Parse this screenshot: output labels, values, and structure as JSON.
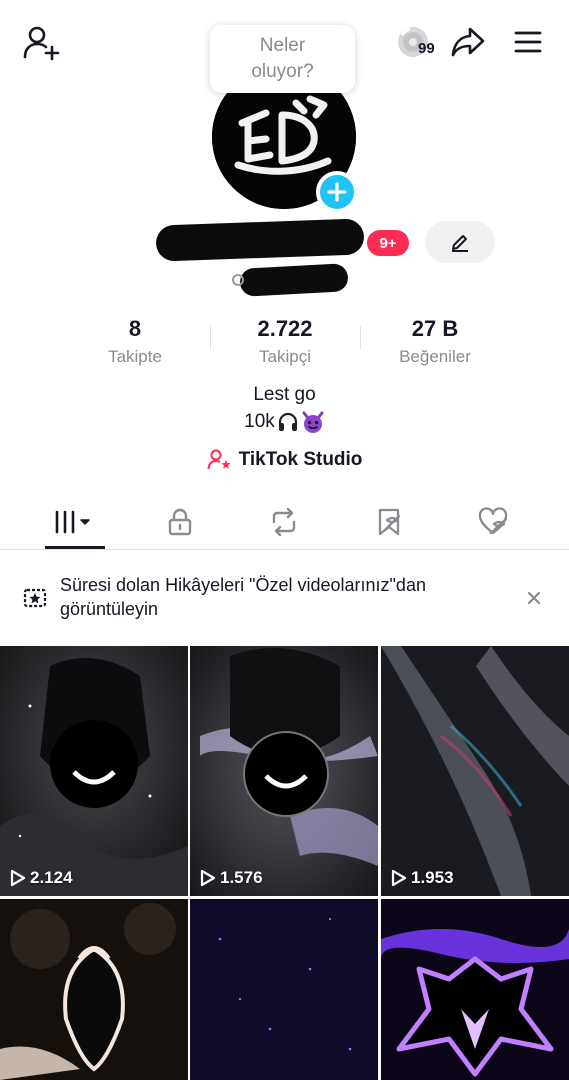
{
  "header": {
    "bubble_text": "Neler oluyor?",
    "coins_count": "99",
    "icons": [
      "add-friend-icon",
      "coin-icon",
      "share-icon",
      "menu-icon"
    ]
  },
  "profile": {
    "notification_badge": "9+",
    "stats": [
      {
        "value": "8",
        "label": "Takipte"
      },
      {
        "value": "2.722",
        "label": "Takipçi"
      },
      {
        "value": "27 B",
        "label": "Beğeniler"
      }
    ],
    "bio_line1": "Lest go",
    "bio_line2": "10k",
    "studio_label": "TikTok Studio"
  },
  "tabs": [
    {
      "icon": "grid-icon",
      "active": true
    },
    {
      "icon": "lock-icon",
      "active": false
    },
    {
      "icon": "repost-icon",
      "active": false
    },
    {
      "icon": "saved-icon",
      "active": false
    },
    {
      "icon": "liked-icon",
      "active": false
    }
  ],
  "notice": {
    "text": "Süresi dolan Hikâyeleri \"Özel videolarınız\"dan görüntüleyin"
  },
  "videos": [
    {
      "views": "2.124"
    },
    {
      "views": "1.576"
    },
    {
      "views": "1.953"
    },
    {
      "views": ""
    },
    {
      "views": ""
    },
    {
      "views": ""
    }
  ],
  "colors": {
    "accent_pink": "#fe2c55",
    "accent_cyan": "#20c4f4",
    "text_primary": "#161823",
    "text_secondary": "#8a8b91"
  }
}
